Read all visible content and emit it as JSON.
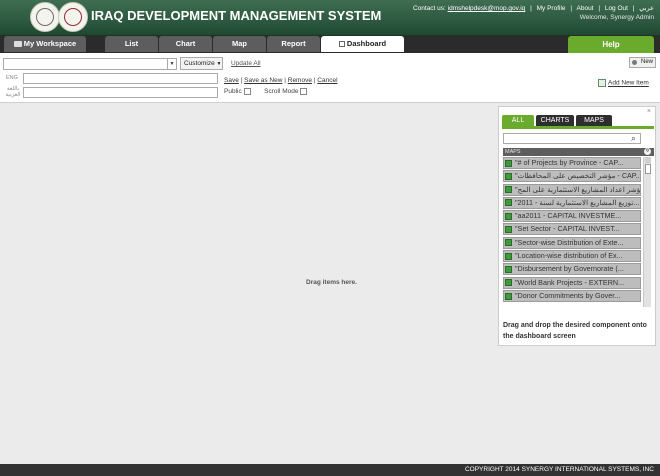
{
  "app": {
    "title": "IRAQ DEVELOPMENT MANAGEMENT SYSTEM"
  },
  "top_links": {
    "contact_label": "Contact us:",
    "email": "idmshelpdesk@mop.gov.iq",
    "profile": "My Profile",
    "about": "About",
    "logout": "Log Out",
    "arabic": "عربي",
    "welcome": "Welcome,  Synergy Admin"
  },
  "tabs": {
    "workspace": "My Workspace",
    "list": "List",
    "chart": "Chart",
    "map": "Map",
    "report": "Report",
    "dashboard": "Dashboard",
    "help": "Help"
  },
  "toolbar": {
    "customize": "Customize",
    "update_all": "Update All",
    "eng_label": "ENG",
    "arabic_label": "باللغة العربية",
    "save": "Save",
    "save_as_new": "Save as New",
    "remove": "Remove",
    "cancel": "Cancel",
    "public": "Public",
    "scroll_mode": "Scroll Mode",
    "new": "New",
    "add_new_item": "Add New Item"
  },
  "canvas": {
    "drop_hint": "Drag items here."
  },
  "panel": {
    "close": "×",
    "tabs": {
      "all": "ALL",
      "charts": "CHARTS",
      "maps": "MAPS"
    },
    "section": "MAPS",
    "items": [
      "\"# of Projects by Province - CAP...",
      "\"مؤشر التخصيص على المحافظات - CAP...",
      "\"مؤشر اعداد المشاريع الاستثمارية على المح...",
      "\"2011 - توزيع المشاريع الاستثمارية لسنة...",
      "\"aa2011 - CAPITAL INVESTME...",
      "\"Set Sector - CAPITAL INVEST...",
      "\"Sector-wise Distribution of Exte...",
      "\"Location-wise distribution of Ex...",
      "\"Disbursement by Governorate (...",
      "\"World Bank Projects - EXTERN...",
      "\"Donor Commitments by Gover..."
    ],
    "hint": "Drag and drop the desired component onto the dashboard screen"
  },
  "footer": {
    "copyright": "COPYRIGHT 2014 SYNERGY INTERNATIONAL SYSTEMS, INC"
  }
}
